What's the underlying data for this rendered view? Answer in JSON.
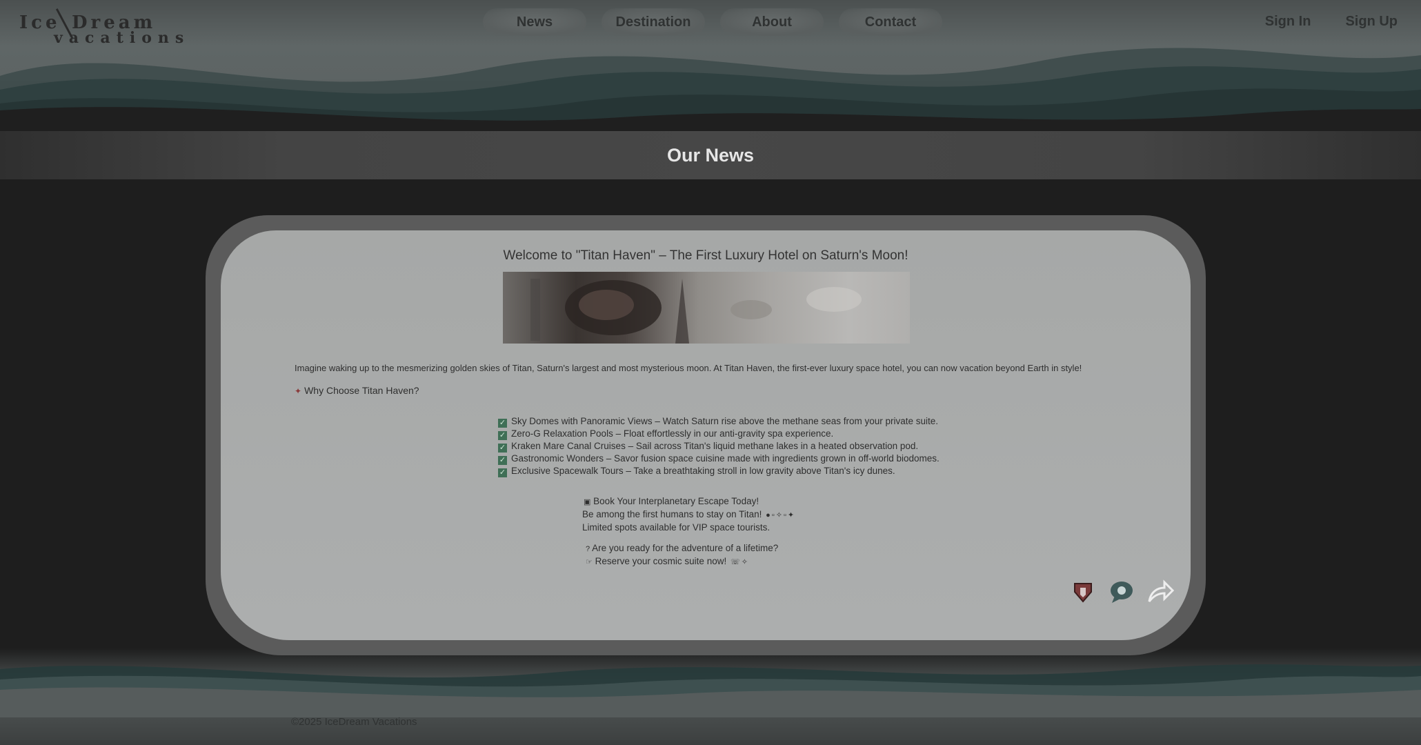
{
  "brand": {
    "logo_line1": "Ice",
    "logo_line2": "Dream",
    "logo_line3": "vacations"
  },
  "nav": {
    "items": [
      {
        "label": "News"
      },
      {
        "label": "Destination"
      },
      {
        "label": "About"
      },
      {
        "label": "Contact"
      }
    ]
  },
  "auth": {
    "sign_in": "Sign In",
    "sign_up": "Sign Up"
  },
  "page": {
    "title": "Our News"
  },
  "article": {
    "title": "Welcome to \"Titan Haven\" – The First Luxury Hotel on Saturn's Moon!",
    "intro": "Imagine waking up to the mesmerizing golden skies of Titan, Saturn's largest and most mysterious moon. At Titan Haven, the first-ever luxury space hotel, you can now vacation beyond Earth in style!",
    "why_heading": "Why Choose Titan Haven?",
    "features": [
      "Sky Domes with Panoramic Views – Watch Saturn rise above the methane seas from your private suite.",
      "Zero-G Relaxation Pools – Float effortlessly in our anti-gravity spa experience.",
      "Kraken Mare Canal Cruises – Sail across Titan's liquid methane lakes in a heated observation pod.",
      "Gastronomic Wonders – Savor fusion space cuisine made with ingredients grown in off-world biodomes.",
      "Exclusive Spacewalk Tours – Take a breathtaking stroll in low gravity above Titan's icy dunes."
    ],
    "cta_heading": "Book Your Interplanetary Escape Today!",
    "cta_line1": "Be among the first humans to stay on Titan!",
    "cta_line2": "Limited spots available for VIP space tourists.",
    "closing_line1": "Are you ready for the adventure of a lifetime?",
    "closing_line2": "Reserve your cosmic suite now!"
  },
  "footer": {
    "copyright": "©2025 IceDream Vacations"
  },
  "icons": {
    "like": "thumbs-up-icon",
    "comment": "comment-icon",
    "share": "share-icon"
  },
  "colors": {
    "page_bg": "#1e1e1e",
    "card_bg": "#a9abaa",
    "accent_teal": "#2f4c4c",
    "check_green": "#3f6f56"
  }
}
